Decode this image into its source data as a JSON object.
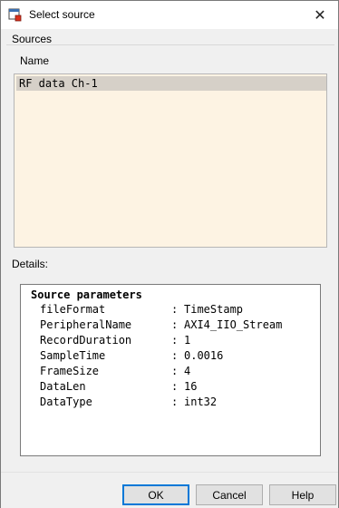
{
  "window": {
    "title": "Select source",
    "icon": "matlab-simulink-icon",
    "close_glyph": "✕"
  },
  "sources": {
    "section_label": "Sources",
    "column_header": "Name",
    "items": [
      {
        "label": "RF data Ch-1",
        "selected": true
      }
    ]
  },
  "details": {
    "section_label": "Details:",
    "heading": "Source parameters",
    "params": [
      {
        "key": "fileFormat",
        "value": "TimeStamp"
      },
      {
        "key": "PeripheralName",
        "value": "AXI4_IIO_Stream"
      },
      {
        "key": "RecordDuration",
        "value": "1"
      },
      {
        "key": "SampleTime",
        "value": "0.0016"
      },
      {
        "key": "FrameSize",
        "value": "4"
      },
      {
        "key": "DataLen",
        "value": "16"
      },
      {
        "key": "DataType",
        "value": "int32"
      }
    ],
    "separator": ":"
  },
  "buttons": {
    "ok_label": "OK",
    "cancel_label": "Cancel",
    "help_label": "Help"
  },
  "colors": {
    "list_background": "#fdf3e3",
    "selected_row": "#d6d0c8",
    "default_button_border": "#0078d7"
  }
}
